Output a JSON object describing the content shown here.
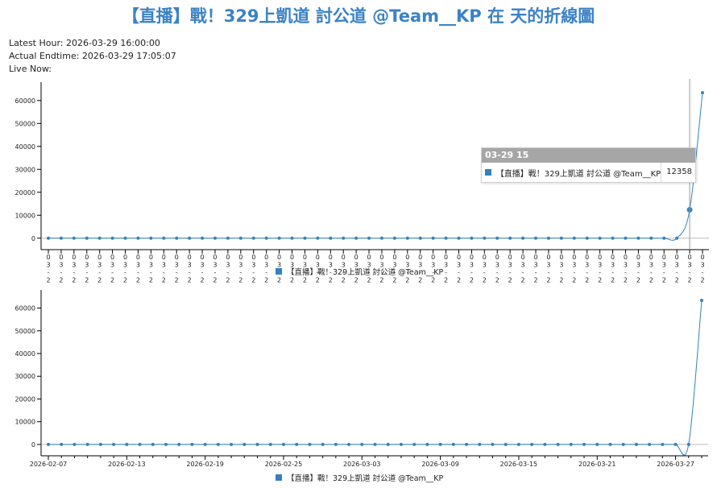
{
  "page": {
    "title": "【直播】戰！329上凱道 討公道 @Team__KP 在 天的折線圖",
    "latest_hour": "Latest Hour: 2026-03-29 16:00:00",
    "actual_endtime": "Actual Endtime: 2026-03-29 17:05:07",
    "live_now": "Live Now:"
  },
  "colors": {
    "series": "#3382bf",
    "title": "#3b82c4",
    "tooltip_header": "#a6a6a6"
  },
  "tooltip": {
    "header": "03-29 15",
    "series_name": "【直播】戰！329上凱道 討公道 @Team__KP",
    "value": "12358"
  },
  "chart_data": [
    {
      "type": "line",
      "series": [
        {
          "name": "【直播】戰！329上凱道 討公道 @Team__KP",
          "values": [
            0,
            0,
            0,
            0,
            0,
            0,
            0,
            0,
            0,
            0,
            0,
            0,
            0,
            0,
            0,
            0,
            0,
            0,
            0,
            0,
            0,
            0,
            0,
            0,
            0,
            0,
            0,
            0,
            0,
            0,
            0,
            0,
            0,
            0,
            0,
            0,
            0,
            0,
            0,
            0,
            0,
            0,
            0,
            0,
            0,
            0,
            0,
            0,
            0,
            0,
            12358,
            63400
          ]
        }
      ],
      "ylim": [
        -5000,
        68000
      ],
      "yticks": [
        0,
        10000,
        20000,
        30000,
        40000,
        50000,
        60000
      ],
      "x_tick_label_fragment": [
        "0",
        "3",
        "-",
        "2"
      ],
      "legend": "bottom-center",
      "grid": false,
      "highlight_index": 50
    },
    {
      "type": "line",
      "series": [
        {
          "name": "【直播】戰！329上凱道 討公道 @Team__KP",
          "x": [
            "2026-02-07",
            "2026-02-08",
            "2026-02-09",
            "2026-02-10",
            "2026-02-11",
            "2026-02-12",
            "2026-02-13",
            "2026-02-14",
            "2026-02-15",
            "2026-02-16",
            "2026-02-17",
            "2026-02-18",
            "2026-02-19",
            "2026-02-20",
            "2026-02-21",
            "2026-02-22",
            "2026-02-23",
            "2026-02-24",
            "2026-02-25",
            "2026-02-26",
            "2026-02-27",
            "2026-02-28",
            "2026-03-01",
            "2026-03-02",
            "2026-03-03",
            "2026-03-04",
            "2026-03-05",
            "2026-03-06",
            "2026-03-07",
            "2026-03-08",
            "2026-03-09",
            "2026-03-10",
            "2026-03-11",
            "2026-03-12",
            "2026-03-13",
            "2026-03-14",
            "2026-03-15",
            "2026-03-16",
            "2026-03-17",
            "2026-03-18",
            "2026-03-19",
            "2026-03-20",
            "2026-03-21",
            "2026-03-22",
            "2026-03-23",
            "2026-03-24",
            "2026-03-25",
            "2026-03-26",
            "2026-03-27",
            "2026-03-28",
            "2026-03-29"
          ],
          "values": [
            0,
            0,
            0,
            0,
            0,
            0,
            0,
            0,
            0,
            0,
            0,
            0,
            0,
            0,
            0,
            0,
            0,
            0,
            0,
            0,
            0,
            0,
            0,
            0,
            0,
            0,
            0,
            0,
            0,
            0,
            0,
            0,
            0,
            0,
            0,
            0,
            0,
            0,
            0,
            0,
            0,
            0,
            0,
            0,
            0,
            0,
            0,
            0,
            0,
            0,
            63400
          ]
        }
      ],
      "xticks": [
        "2026-02-07",
        "2026-02-13",
        "2026-02-19",
        "2026-02-25",
        "2026-03-03",
        "2026-03-09",
        "2026-03-15",
        "2026-03-21",
        "2026-03-27"
      ],
      "ylim": [
        -5000,
        68000
      ],
      "yticks": [
        0,
        10000,
        20000,
        30000,
        40000,
        50000,
        60000
      ],
      "legend": "bottom-center",
      "grid": false
    }
  ]
}
